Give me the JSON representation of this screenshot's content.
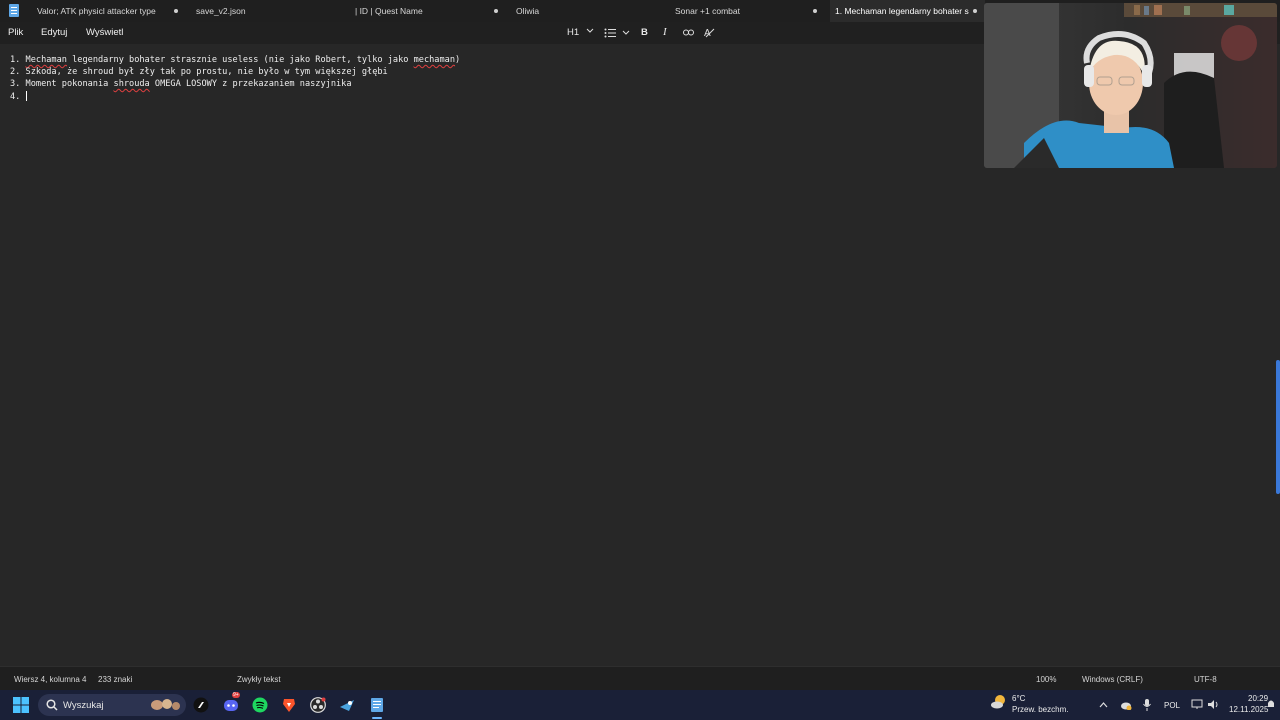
{
  "tabs": [
    {
      "label": "Valor; ATK physicl attacker type",
      "modified": true
    },
    {
      "label": "save_v2.json",
      "modified": false
    },
    {
      "label": "| ID | Quest Name",
      "modified": true
    },
    {
      "label": "Oliwia",
      "modified": false
    },
    {
      "label": "Sonar +1 combat",
      "modified": true
    },
    {
      "label": "1. Mechaman legendarny bohater s",
      "modified": true,
      "active": true
    }
  ],
  "menu": {
    "file": "Plik",
    "edit": "Edytuj",
    "view": "Wyświetl"
  },
  "toolbar": {
    "heading": "H1",
    "bold": "B",
    "italic": "I",
    "list_icon": "bulleted-list-icon",
    "link_icon": "link-icon",
    "clear_format_icon": "clear-formatting-icon"
  },
  "editor": {
    "lines": [
      {
        "num": "1.",
        "segments": [
          {
            "t": "Mechaman",
            "err": true
          },
          {
            "t": " legendarny bohater strasznie useless (nie jako Robert, tylko jako "
          },
          {
            "t": "mechaman",
            "err": true
          },
          {
            "t": ")"
          }
        ]
      },
      {
        "num": "2.",
        "segments": [
          {
            "t": "Szkoda, że shroud był zły tak po prostu, nie było w tym większej głębi"
          }
        ]
      },
      {
        "num": "3.",
        "segments": [
          {
            "t": "Moment pokonania "
          },
          {
            "t": "shrouda",
            "err": true
          },
          {
            "t": " OMEGA LOSOWY z przekazaniem naszyjnika"
          }
        ]
      },
      {
        "num": "4.",
        "segments": []
      }
    ]
  },
  "status": {
    "position": "Wiersz 4, kolumna 4",
    "chars": "233 znaki",
    "format": "Zwykły tekst",
    "zoom": "100%",
    "line_endings": "Windows (CRLF)",
    "encoding": "UTF-8"
  },
  "taskbar": {
    "search_placeholder": "Wyszukaj",
    "discord_badge": "9+"
  },
  "tray": {
    "temperature": "6°C",
    "weather": "Przew. bezchm.",
    "language": "POL",
    "time": "20:29",
    "date": "12.11.2025"
  },
  "colors": {
    "accent": "#3a78d8",
    "spellcheck": "#e04040",
    "editor_bg": "#272727",
    "taskbar_bg": "#1a2037"
  }
}
